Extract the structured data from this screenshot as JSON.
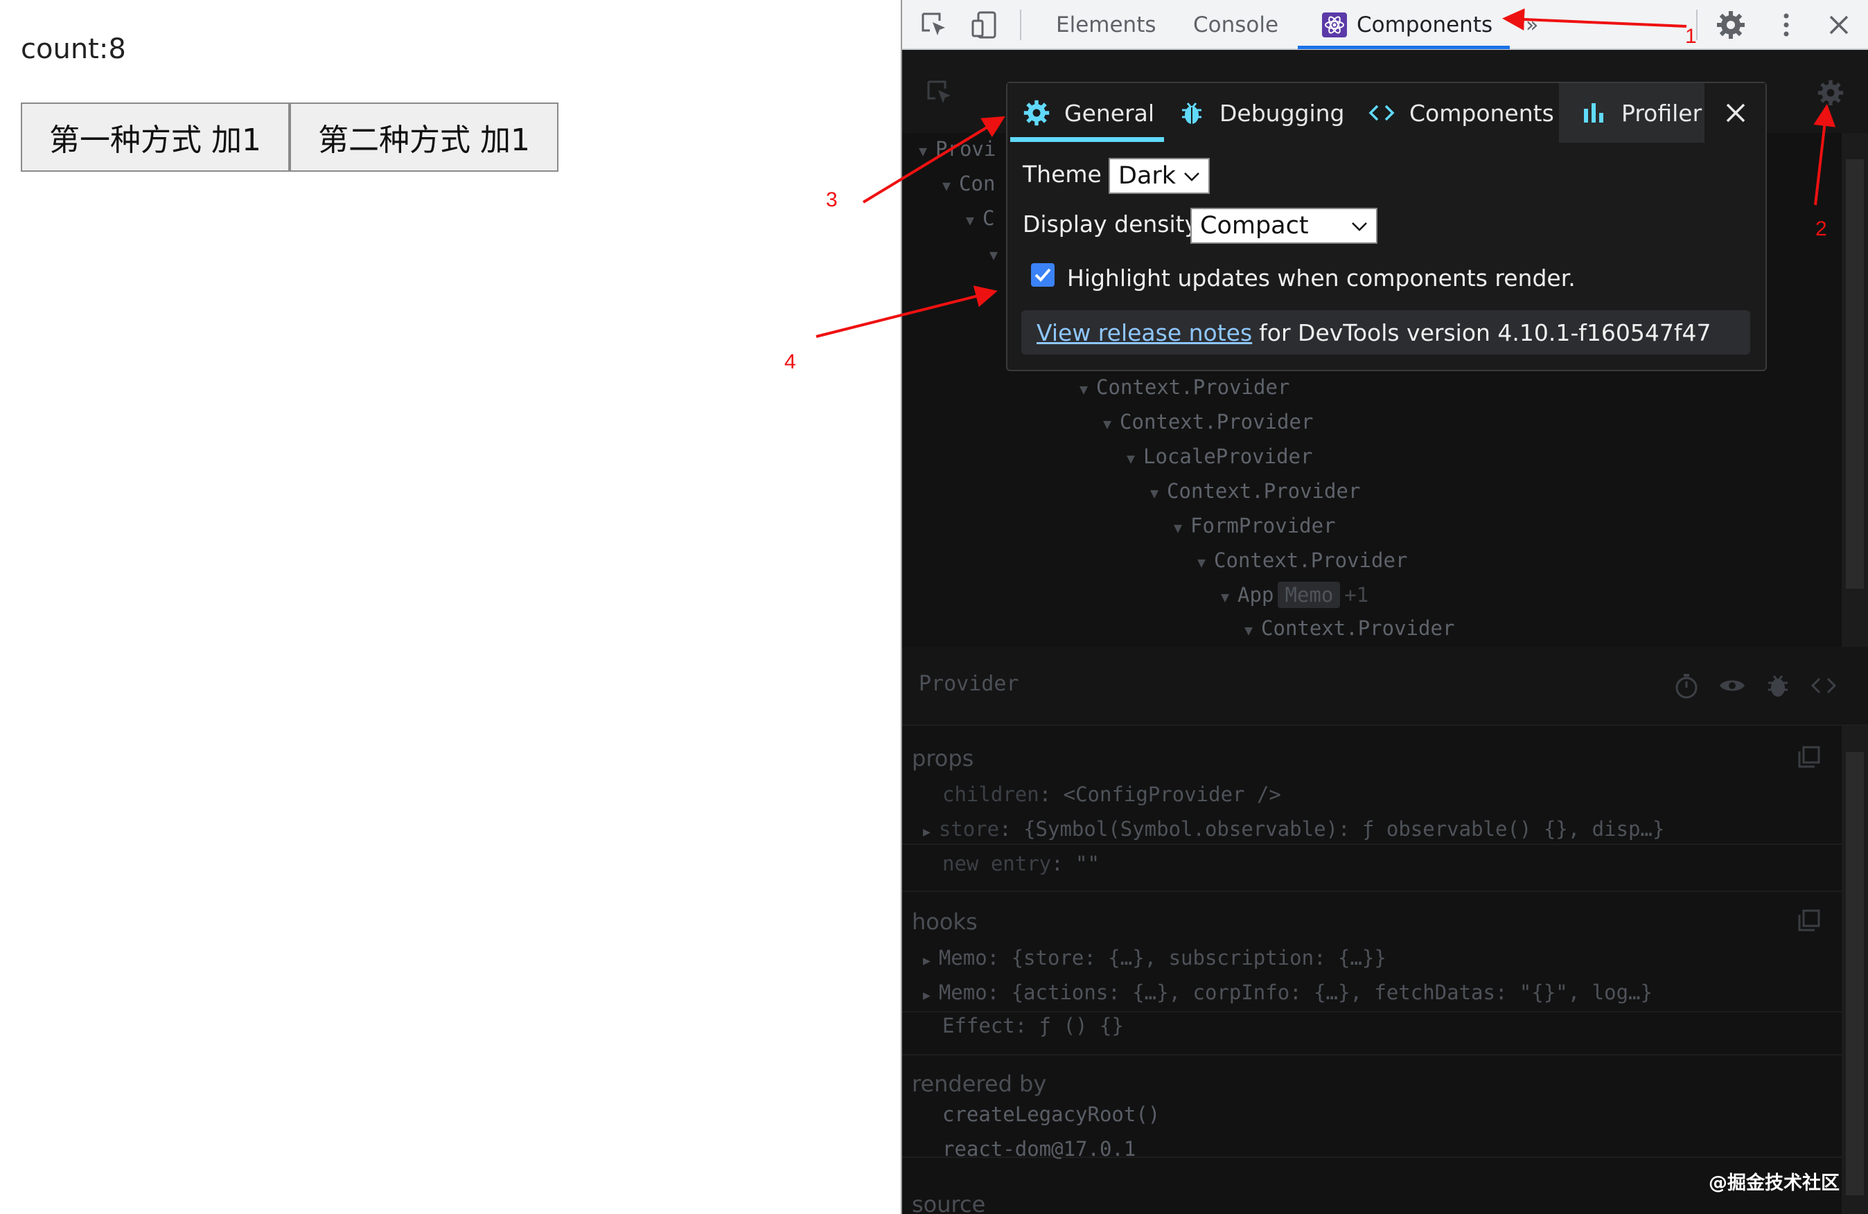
{
  "page": {
    "count_text": "count:8",
    "button1_label": "第一种方式 加1",
    "button2_label": "第二种方式 加1"
  },
  "devtools": {
    "tabs": [
      {
        "label": "Elements"
      },
      {
        "label": "Console"
      },
      {
        "label": "Components",
        "active": true
      }
    ],
    "overflow": "»",
    "tree": [
      "Provi",
      "Con",
      "C",
      "Context.Provider",
      "Context.Provider",
      "LocaleProvider",
      "Context.Provider",
      "FormProvider",
      "Context.Provider",
      "App",
      "Context.Provider"
    ],
    "app_badge": "Memo",
    "app_extra": "+1",
    "selected_name": "Provider",
    "props_title": "props",
    "props": [
      {
        "key": "children",
        "value": ": <ConfigProvider />"
      },
      {
        "key": "store",
        "value": ": {Symbol(Symbol.observable): ƒ observable() {}, disp…}"
      },
      {
        "key": "new entry",
        "value": ": \"\""
      }
    ],
    "hooks_title": "hooks",
    "hooks": [
      "Memo: {store: {…}, subscription: {…}}",
      "Memo: {actions: {…}, corpInfo: {…}, fetchDatas: \"{}\", log…}",
      "Effect: ƒ () {}"
    ],
    "rendered_by_title": "rendered by",
    "rendered_by": [
      "createLegacyRoot()",
      "react-dom@17.0.1"
    ],
    "source_title": "source"
  },
  "settings": {
    "tabs": [
      "General",
      "Debugging",
      "Components",
      "Profiler"
    ],
    "theme_label": "Theme",
    "theme_value": "Dark",
    "density_label": "Display density",
    "density_value": "Compact",
    "highlight_label": "Highlight updates when components render.",
    "highlight_checked": true,
    "release_link": "View release notes",
    "release_text": "for DevTools version 4.10.1-f160547f47"
  },
  "annotations": [
    "1",
    "2",
    "3",
    "4"
  ],
  "watermark": "@掘金技术社区",
  "colors": {
    "arrow": "#ee1111",
    "accent": "#61dafb",
    "tab_underline": "#1a73e8"
  }
}
